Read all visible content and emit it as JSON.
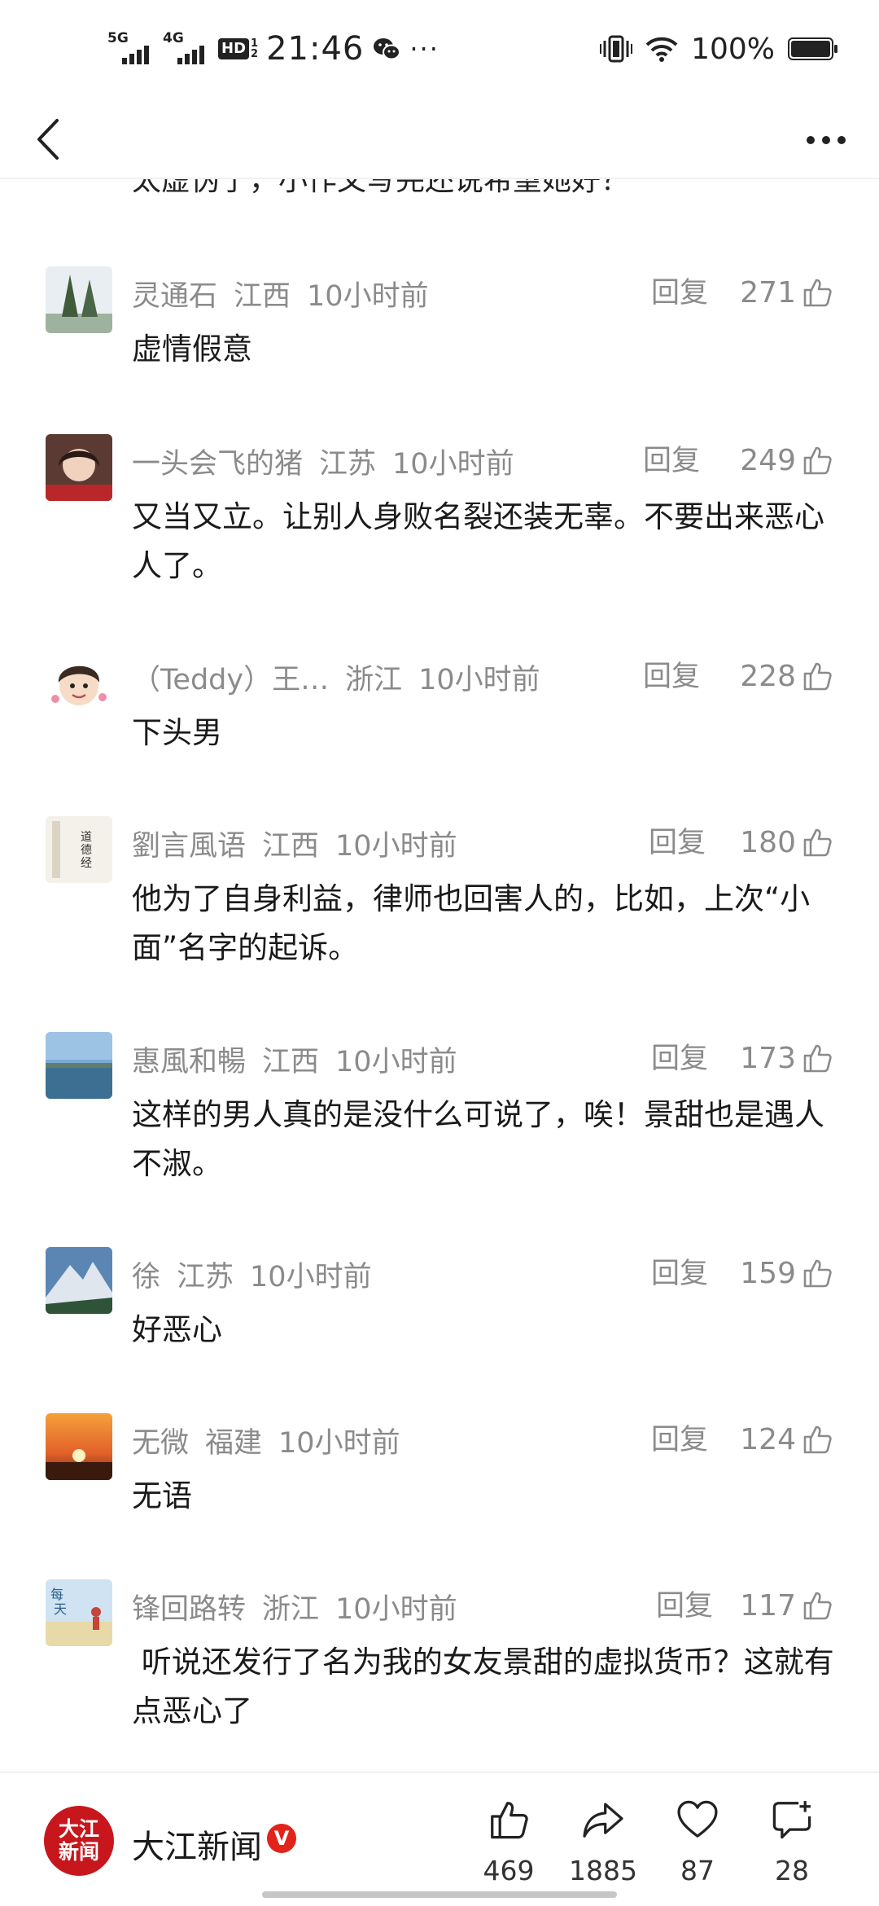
{
  "status_bar": {
    "net1": "5G",
    "net2": "4G",
    "hd": "HD",
    "hd_top": "1",
    "hd_bottom": "2",
    "time": "21:46",
    "more": "···",
    "battery": "100%"
  },
  "nav": {
    "back_icon": "chevron-left",
    "menu_icon": "more-horizontal"
  },
  "partial_comment": "太虚伪了，小作文写完还说希望她好？",
  "reply_label": "回复",
  "comments": [
    {
      "user": "灵通石",
      "region": "江西",
      "time": "10小时前",
      "likes": "271",
      "text": "虚情假意"
    },
    {
      "user": "一头会飞的猪",
      "region": "江苏",
      "time": "10小时前",
      "likes": "249",
      "text": "又当又立。让别人身败名裂还装无辜。不要出来恶心人了。"
    },
    {
      "user": "（Teddy）王…",
      "region": "浙江",
      "time": "10小时前",
      "likes": "228",
      "text": "下头男"
    },
    {
      "user": "劉言風语",
      "region": "江西",
      "time": "10小时前",
      "likes": "180",
      "text": "他为了自身利益，律师也回害人的，比如，上次“小面”名字的起诉。"
    },
    {
      "user": "惠風和暢",
      "region": "江西",
      "time": "10小时前",
      "likes": "173",
      "text": "这样的男人真的是没什么可说了，唉！景甜也是遇人不淑。"
    },
    {
      "user": "徐",
      "region": "江苏",
      "time": "10小时前",
      "likes": "159",
      "text": "好恶心"
    },
    {
      "user": "无微",
      "region": "福建",
      "time": "10小时前",
      "likes": "124",
      "text": "无语"
    },
    {
      "user": "锋回路转",
      "region": "浙江",
      "time": "10小时前",
      "likes": "117",
      "text": " 听说还发行了名为我的女友景甜的虚拟货币？这就有点恶心了"
    }
  ],
  "bottom": {
    "logo_line1": "大江",
    "logo_line2": "新闻",
    "name": "大江新闻",
    "verified": "V",
    "like_count": "469",
    "share_count": "1885",
    "favorite_count": "87",
    "comment_count": "28"
  },
  "colors": {
    "meta_gray": "#8b8b8b",
    "brand_red": "#c8161d",
    "verified_red": "#e2231a"
  }
}
